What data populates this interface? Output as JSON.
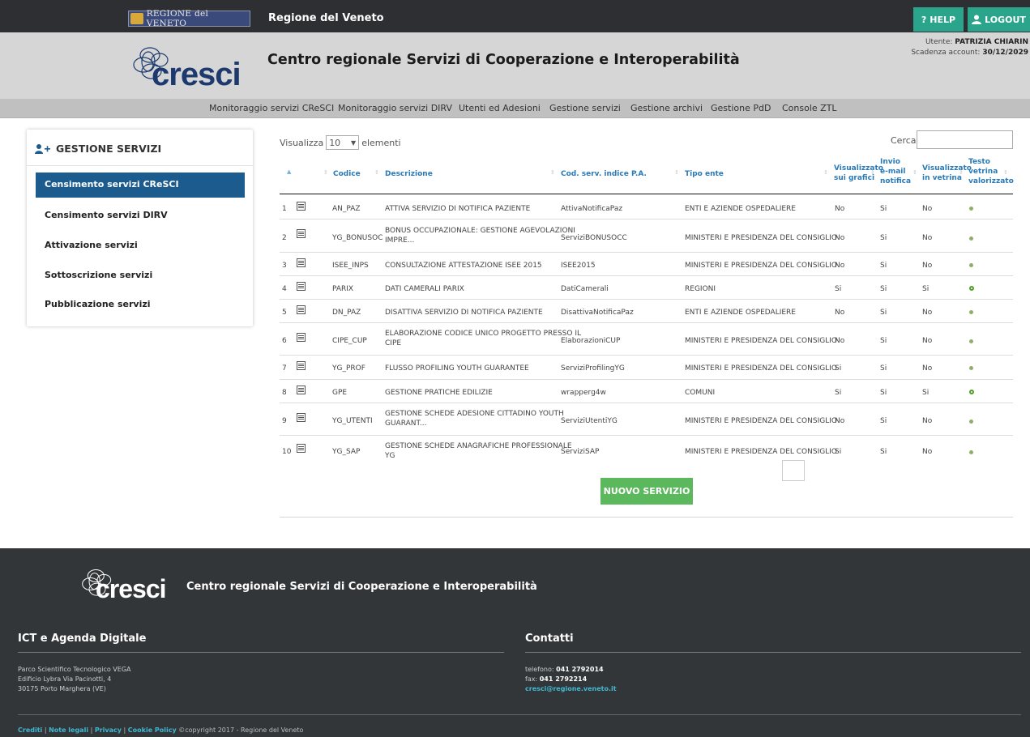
{
  "topbar": {
    "regione_logo_text": "REGIONE del VENETO",
    "title": "Regione del Veneto",
    "help_label": "HELP",
    "logout_label": "LOGOUT"
  },
  "header": {
    "logo_text": "cresci",
    "title": "Centro regionale Servizi di Cooperazione e Interoperabilità",
    "user_label": "Utente:",
    "user_name": "PATRIZIA CHIARIN",
    "expiry_label": "Scadenza account:",
    "expiry_date": "30/12/2029"
  },
  "nav": {
    "items": [
      "Monitoraggio servizi CReSCI",
      "Monitoraggio servizi DIRV",
      "Utenti ed Adesioni",
      "Gestione servizi",
      "Gestione archivi",
      "Gestione PdD",
      "Console ZTL"
    ]
  },
  "sidebar": {
    "title": "GESTIONE SERVIZI",
    "items": [
      {
        "label": "Censimento servizi CReSCI",
        "active": true
      },
      {
        "label": "Censimento servizi DIRV",
        "active": false
      },
      {
        "label": "Attivazione servizi",
        "active": false
      },
      {
        "label": "Sottoscrizione servizi",
        "active": false
      },
      {
        "label": "Pubblicazione servizi",
        "active": false
      }
    ]
  },
  "table_controls": {
    "show_prefix": "Visualizza",
    "show_value": "10",
    "show_suffix": "elementi",
    "search_label": "Cerca:",
    "search_value": ""
  },
  "table": {
    "headers": {
      "codice": "Codice",
      "descrizione": "Descrizione",
      "cod_serv": "Cod. serv. indice P.A.",
      "tipo_ente": "Tipo ente",
      "vis_grafici": [
        "Visualizzato",
        "sui grafici"
      ],
      "invio_email": [
        "Invio",
        "e-mail",
        "notifica"
      ],
      "vis_vetrina": [
        "Visualizzato",
        "in vetrina"
      ],
      "testo_vetrina": [
        "Testo",
        "vetrina",
        "valorizzato"
      ]
    },
    "rows": [
      {
        "n": "1",
        "codice": "AN_PAZ",
        "descrizione": [
          "ATTIVA SERVIZIO DI NOTIFICA PAZIENTE"
        ],
        "cod_serv": "AttivaNotificaPaz",
        "tipo_ente": "ENTI E AZIENDE OSPEDALIERE",
        "grafici": "No",
        "email": "Si",
        "vetrina": "No",
        "testo": false
      },
      {
        "n": "2",
        "codice": "YG_BONUSOC",
        "descrizione": [
          "BONUS OCCUPAZIONALE: GESTIONE AGEVOLAZIONI",
          "IMPRE..."
        ],
        "cod_serv": "ServiziBONUSOCC",
        "tipo_ente": "MINISTERI E PRESIDENZA DEL CONSIGLIO",
        "grafici": "No",
        "email": "Si",
        "vetrina": "No",
        "testo": false
      },
      {
        "n": "3",
        "codice": "ISEE_INPS",
        "descrizione": [
          "CONSULTAZIONE ATTESTAZIONE ISEE 2015"
        ],
        "cod_serv": "ISEE2015",
        "tipo_ente": "MINISTERI E PRESIDENZA DEL CONSIGLIO",
        "grafici": "No",
        "email": "Si",
        "vetrina": "No",
        "testo": false
      },
      {
        "n": "4",
        "codice": "PARIX",
        "descrizione": [
          "DATI CAMERALI PARIX"
        ],
        "cod_serv": "DatiCamerali",
        "tipo_ente": "REGIONI",
        "grafici": "Si",
        "email": "Si",
        "vetrina": "Si",
        "testo": true
      },
      {
        "n": "5",
        "codice": "DN_PAZ",
        "descrizione": [
          "DISATTIVA SERVIZIO DI NOTIFICA PAZIENTE"
        ],
        "cod_serv": "DisattivaNotificaPaz",
        "tipo_ente": "ENTI E AZIENDE OSPEDALIERE",
        "grafici": "No",
        "email": "Si",
        "vetrina": "No",
        "testo": false
      },
      {
        "n": "6",
        "codice": "CIPE_CUP",
        "descrizione": [
          "ELABORAZIONE CODICE UNICO PROGETTO PRESSO IL",
          "CIPE"
        ],
        "cod_serv": "ElaborazioniCUP",
        "tipo_ente": "MINISTERI E PRESIDENZA DEL CONSIGLIO",
        "grafici": "No",
        "email": "Si",
        "vetrina": "No",
        "testo": false
      },
      {
        "n": "7",
        "codice": "YG_PROF",
        "descrizione": [
          "FLUSSO PROFILING YOUTH GUARANTEE"
        ],
        "cod_serv": "ServiziProfilingYG",
        "tipo_ente": "MINISTERI E PRESIDENZA DEL CONSIGLIO",
        "grafici": "Si",
        "email": "Si",
        "vetrina": "No",
        "testo": false
      },
      {
        "n": "8",
        "codice": "GPE",
        "descrizione": [
          "GESTIONE PRATICHE EDILIZIE"
        ],
        "cod_serv": "wrapperg4w",
        "tipo_ente": "COMUNI",
        "grafici": "Si",
        "email": "Si",
        "vetrina": "Si",
        "testo": true
      },
      {
        "n": "9",
        "codice": "YG_UTENTI",
        "descrizione": [
          "GESTIONE SCHEDE ADESIONE CITTADINO YOUTH",
          "GUARANT..."
        ],
        "cod_serv": "ServiziUtentiYG",
        "tipo_ente": "MINISTERI E PRESIDENZA DEL CONSIGLIO",
        "grafici": "No",
        "email": "Si",
        "vetrina": "No",
        "testo": false
      },
      {
        "n": "10",
        "codice": "YG_SAP",
        "descrizione": [
          "GESTIONE SCHEDE ANAGRAFICHE PROFESSIONALE",
          "YG"
        ],
        "cod_serv": "ServiziSAP",
        "tipo_ente": "MINISTERI E PRESIDENZA DEL CONSIGLIO",
        "grafici": "Si",
        "email": "Si",
        "vetrina": "No",
        "testo": false
      }
    ]
  },
  "new_service_label": "NUOVO SERVIZIO",
  "footer": {
    "logo_text": "cresci",
    "title": "Centro regionale Servizi di Cooperazione e Interoperabilità",
    "ict_heading": "ICT e Agenda Digitale",
    "address": [
      "Parco Scientifico Tecnologico VEGA",
      "Edificio Lybra Via Pacinotti, 4",
      "30175 Porto Marghera (VE)"
    ],
    "contacts_heading": "Contatti",
    "phone_label": "telefono:",
    "phone": "041 2792014",
    "fax_label": "fax:",
    "fax": "041 2792214",
    "email": "cresci@regione.veneto.it",
    "links": [
      "Crediti",
      "Note legali",
      "Privacy",
      "Cookie Policy"
    ],
    "copyright": "©copyright 2017 - Regione del Veneto"
  }
}
